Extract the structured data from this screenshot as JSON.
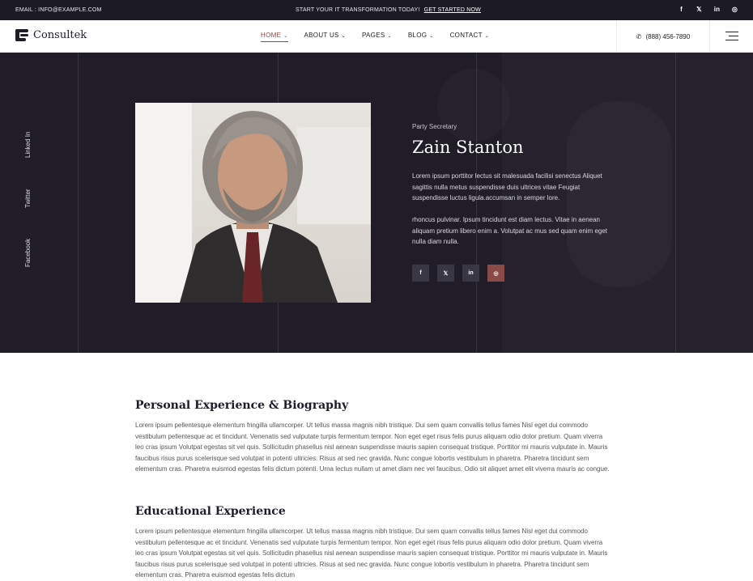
{
  "topbar": {
    "email": "EMAIL : INFO@EXAMPLE.COM",
    "promo": "START YOUR IT TRANSFORMATION TODAY!",
    "promo_link": "GET STARTED NOW",
    "socials": [
      {
        "icon": "facebook-icon",
        "glyph": "f"
      },
      {
        "icon": "x-icon",
        "glyph": "𝕏"
      },
      {
        "icon": "linkedin-icon",
        "glyph": "in"
      },
      {
        "icon": "instagram-icon",
        "glyph": "◎"
      }
    ]
  },
  "header": {
    "logo_text": "Consultek",
    "nav": [
      {
        "label": "HOME",
        "active": true
      },
      {
        "label": "ABOUT US",
        "active": false
      },
      {
        "label": "PAGES",
        "active": false
      },
      {
        "label": "BLOG",
        "active": false
      },
      {
        "label": "CONTACT",
        "active": false
      }
    ],
    "phone": "(888) 456-7890"
  },
  "hero": {
    "side_links": [
      "Linked In",
      "Twitter",
      "Facebook"
    ],
    "role": "Party Secretary",
    "name": "Zain Stanton",
    "bio_1": "Lorem ipsum porttitor lectus sit malesuada facilisi senectus Aliquet sagittis nulla metus suspendisse duis ultrices vitae Feugiat suspendisse luctus ligula.accumsan in semper lore.",
    "bio_2": "rhoncus pulvinar. Ipsum tincidunt est diam lectus. Vitae in aenean aliquam pretium libero enim a. Volutpat ac mus sed quam enim eget nulla diam nulla.",
    "socials": [
      {
        "icon": "facebook-icon",
        "glyph": "f"
      },
      {
        "icon": "x-icon",
        "glyph": "𝕏"
      },
      {
        "icon": "linkedin-icon",
        "glyph": "in"
      },
      {
        "icon": "instagram-icon",
        "glyph": "◎"
      }
    ],
    "accent_color": "#8a4a46"
  },
  "sections": {
    "biography_title": "Personal Experience & Biography",
    "biography_text": "Lorem ipsum pellentesque elementum fringilla ullamcorper. Ut tellus massa magnis nibh tristique. Dui sem quam convallis tellus fames Nisl eget dui commodo vestibulum pellentesque ac et tincidunt. Venenatis sed vulputate turpis fermentum tempor. Non eget eget risus felis purus aliquam odio dolor pretium. Quam viverra leo cras ipsum Volutpat egestas sit vel quis. Sollicitudin phasellus nisl aenean suspendisse mauris sapien consequat tristique. Porttitor mi mauris vulputate in. Mauris faucibus risus purus scelerisque sed volutpat in potenti ultricies. Risus at sed nec gravida. Nunc congue lobortis vestibulum in pharetra. Pharetra tincidunt sem elementum cras. Pharetra euismod egestas felis dictum potenti. Urna lectus nullam ut amet diam nec vel faucibus. Odio sit aliquet amet elit viverra mauris ac congue.",
    "education_title": "Educational Experience",
    "education_text": "Lorem ipsum pellentesque elementum fringilla ullamcorper. Ut tellus massa magnis nibh tristique. Dui sem quam convallis tellus fames Nisl eget dui commodo vestibulum pellentesque ac et tincidunt. Venenatis sed vulputate turpis fermentum tempor. Non eget eget risus felis purus aliquam odio dolor pretium. Quam viverra leo cras ipsum Volutpat egestas sit vel quis. Sollicitudin phasellus nisl aenean suspendisse mauris sapien consequat tristique. Porttitor mi mauris vulputate in. Mauris faucibus risus purus scelerisque sed volutpat in potenti ultricies. Risus at sed nec gravida. Nunc congue lobortis vestibulum in pharetra. Pharetra tincidunt sem elementum cras. Pharetra euismod egestas felis dictum"
  }
}
